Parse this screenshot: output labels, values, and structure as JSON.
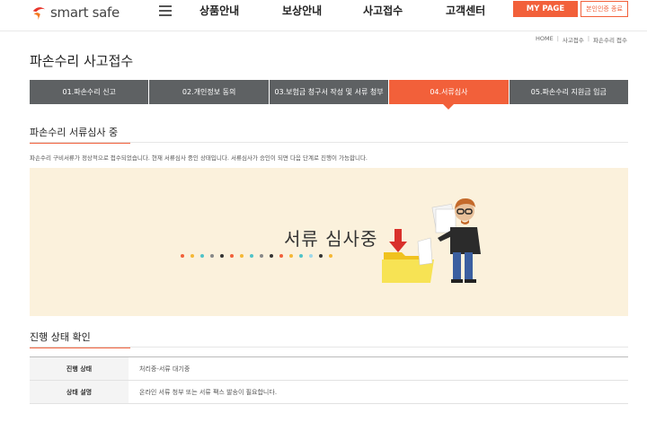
{
  "header": {
    "logo_text": "smart safe",
    "nav": [
      "상품안내",
      "보상안내",
      "사고접수",
      "고객센터"
    ],
    "mypage_label": "MY PAGE",
    "logout_label": "본인인증 종료"
  },
  "breadcrumb": [
    "HOME",
    "사고접수",
    "파손수리 접수"
  ],
  "page_title": "파손수리 사고접수",
  "steps": [
    {
      "label": "01.파손수리 신고",
      "active": false
    },
    {
      "label": "02.개인정보 동의",
      "active": false
    },
    {
      "label": "03.보험금 청구서 작성 및 서류 청부",
      "active": false
    },
    {
      "label": "04.서류심사",
      "active": true
    },
    {
      "label": "05.파손수리 지원금 입금",
      "active": false
    }
  ],
  "review_section": {
    "title": "파손수리 서류심사 중",
    "description": "파손수리 구비서류가 정상적으로 접수되었습니다. 현재 서류심사 중인 상태입니다. 서류심사가 승인이 되면 다음 단계로 진행이 가능합니다.",
    "illustration_text": "서류 심사중",
    "dot_colors": [
      "#f2603a",
      "#f5b835",
      "#4fc3c8",
      "#888888",
      "#333333",
      "#f2603a",
      "#f5b835",
      "#4fc3c8",
      "#888888",
      "#333333",
      "#f2603a",
      "#f5b835",
      "#4fc3c8",
      "#9fd8ea",
      "#333333",
      "#f5b835"
    ]
  },
  "status_section": {
    "title": "진행 상태 확인",
    "rows": [
      {
        "label": "진행 상태",
        "value": "처리중-서류 대기중"
      },
      {
        "label": "상태 설명",
        "value": "온라인 서류 청부 또는 서류 팩스 발송이 필요합니다."
      }
    ]
  },
  "colors": {
    "accent": "#f2603a",
    "step_bg": "#5e6163",
    "illustration_bg": "#fbf1dc"
  }
}
